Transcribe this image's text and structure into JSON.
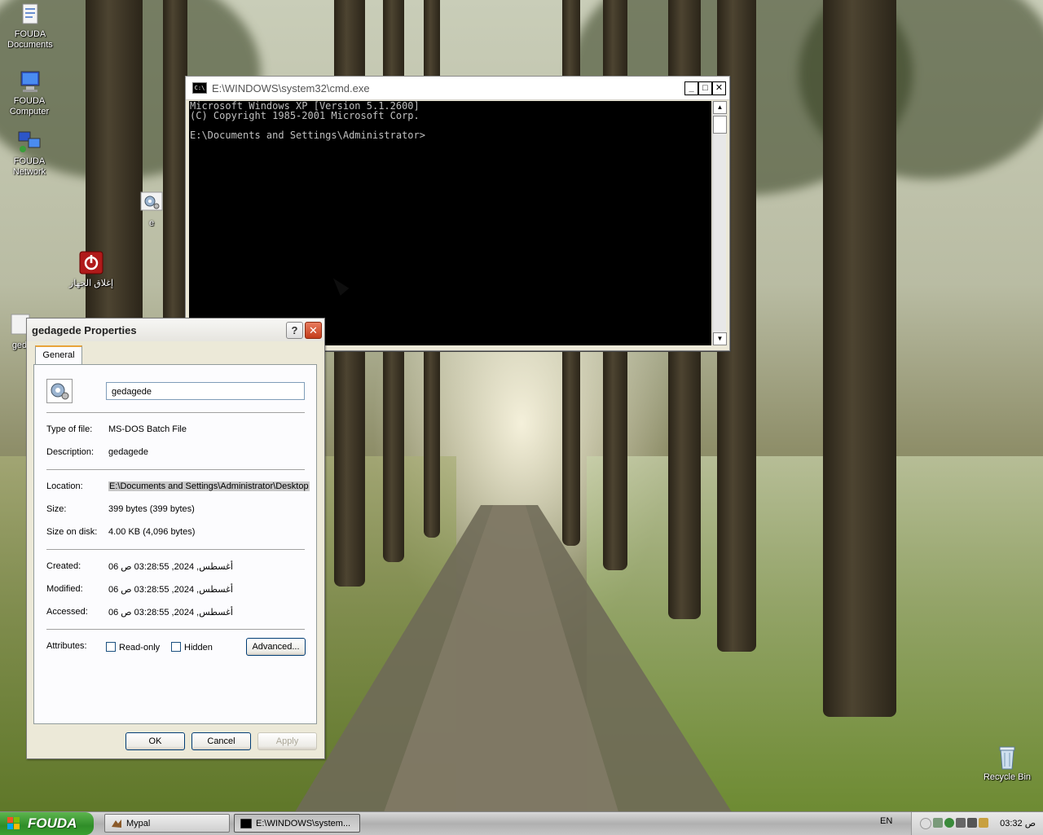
{
  "desktop": {
    "icons": [
      {
        "label_line1": "FOUDA",
        "label_line2": "Documents"
      },
      {
        "label_line1": "FOUDA",
        "label_line2": "Computer"
      },
      {
        "label_line1": "FOUDA",
        "label_line2": "Network"
      },
      {
        "label_line1": "e",
        "label_line2": ""
      },
      {
        "label_line1": "إغلاق الجهاز",
        "label_line2": ""
      },
      {
        "label_line1": "ged",
        "label_line2": ""
      },
      {
        "label_line1": "Recycle Bin",
        "label_line2": ""
      }
    ]
  },
  "cmd_window": {
    "title": "E:\\WINDOWS\\system32\\cmd.exe",
    "icon_text": "C:\\",
    "minimize": "_",
    "maximize": "□",
    "close": "✕",
    "console_lines": [
      "Microsoft Windows XP [Version 5.1.2600]",
      "(C) Copyright 1985-2001 Microsoft Corp.",
      "",
      "E:\\Documents and Settings\\Administrator>"
    ],
    "scroll_up": "▲",
    "scroll_down": "▼"
  },
  "properties_dialog": {
    "title": "gedagede Properties",
    "help_button": "?",
    "close_button": "✕",
    "tab_general": "General",
    "file_name": "gedagede",
    "type_label": "Type of file:",
    "type_value": "MS-DOS Batch File",
    "description_label": "Description:",
    "description_value": "gedagede",
    "location_label": "Location:",
    "location_value": "E:\\Documents and Settings\\Administrator\\Desktop",
    "size_label": "Size:",
    "size_value": "399 bytes (399 bytes)",
    "size_on_disk_label": "Size on disk:",
    "size_on_disk_value": "4.00 KB (4,096 bytes)",
    "created_label": "Created:",
    "created_value": "06 أغسطس, 2024, 03:28:55 ص",
    "modified_label": "Modified:",
    "modified_value": "06 أغسطس, 2024, 03:28:55 ص",
    "accessed_label": "Accessed:",
    "accessed_value": "06 أغسطس, 2024, 03:28:55 ص",
    "attributes_label": "Attributes:",
    "readonly_label": "Read-only",
    "readonly_checked": false,
    "hidden_label": "Hidden",
    "hidden_checked": false,
    "advanced_button": "Advanced...",
    "ok_button": "OK",
    "cancel_button": "Cancel",
    "apply_button": "Apply"
  },
  "taskbar": {
    "start_label": "FOUDA",
    "buttons": [
      {
        "label": "Mypal"
      },
      {
        "label": "E:\\WINDOWS\\system..."
      }
    ],
    "language": "EN",
    "clock": "03:32 ص"
  }
}
